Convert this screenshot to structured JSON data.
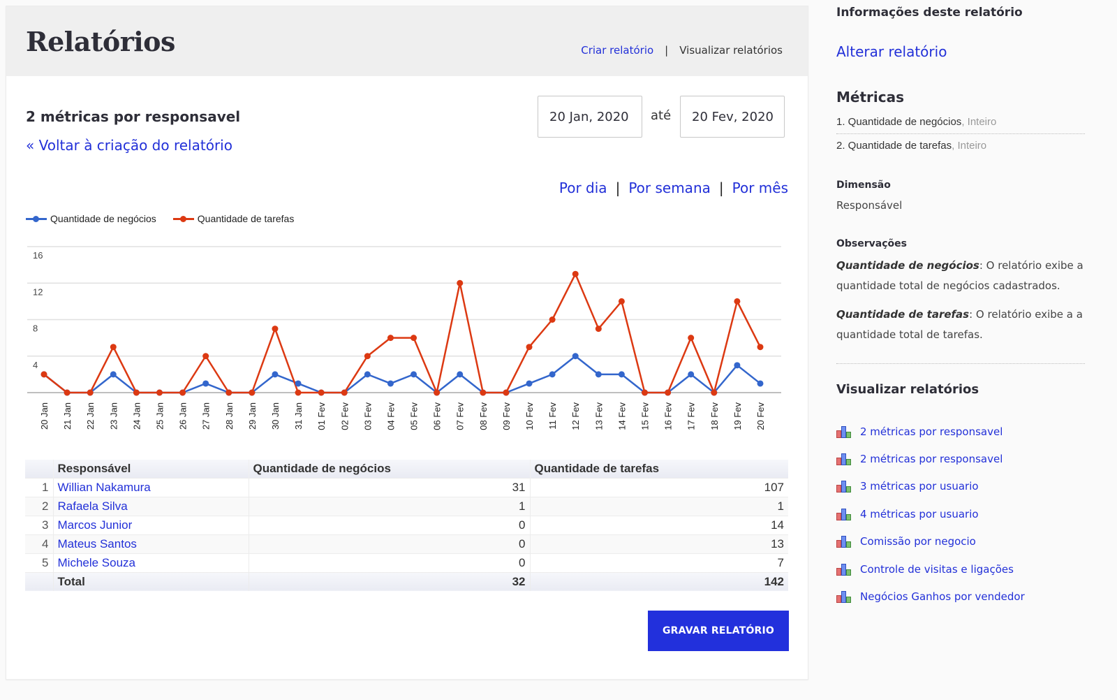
{
  "header": {
    "title": "Relatórios",
    "nav": {
      "create_label": "Criar relatório",
      "separator": "|",
      "view_label": "Visualizar relatórios"
    }
  },
  "report": {
    "name": "2 métricas por responsavel",
    "back_link": "« Voltar à criação do relatório",
    "date_from": "20 Jan, 2020",
    "date_separator": "até",
    "date_to": "20 Fev, 2020",
    "period": {
      "day": "Por dia",
      "week": "Por semana",
      "month": "Por mês",
      "separator": "|"
    }
  },
  "colors": {
    "negocios": "#3366cc",
    "tarefas": "#dc3912",
    "accent": "#2230dc",
    "link": "#2230d8"
  },
  "chart_data": {
    "type": "line",
    "title": "",
    "xlabel": "",
    "ylabel": "",
    "ylim": [
      0,
      16
    ],
    "yticks": [
      4,
      8,
      12,
      16
    ],
    "grid": true,
    "legend": "top-left",
    "x": [
      "20 Jan",
      "21 Jan",
      "22 Jan",
      "23 Jan",
      "24 Jan",
      "25 Jan",
      "26 Jan",
      "27 Jan",
      "28 Jan",
      "29 Jan",
      "30 Jan",
      "31 Jan",
      "01 Fev",
      "02 Fev",
      "03 Fev",
      "04 Fev",
      "05 Fev",
      "06 Fev",
      "07 Fev",
      "08 Fev",
      "09 Fev",
      "10 Fev",
      "11 Fev",
      "12 Fev",
      "13 Fev",
      "14 Fev",
      "15 Fev",
      "16 Fev",
      "17 Fev",
      "18 Fev",
      "19 Fev",
      "20 Fev"
    ],
    "series": [
      {
        "name": "Quantidade de negócios",
        "color": "#3366cc",
        "values": [
          2,
          0,
          0,
          2,
          0,
          0,
          0,
          1,
          0,
          0,
          2,
          1,
          0,
          0,
          2,
          1,
          2,
          0,
          2,
          0,
          0,
          1,
          2,
          4,
          2,
          2,
          0,
          0,
          2,
          0,
          3,
          1
        ]
      },
      {
        "name": "Quantidade de tarefas",
        "color": "#dc3912",
        "values": [
          2,
          0,
          0,
          5,
          0,
          0,
          0,
          4,
          0,
          0,
          7,
          0,
          0,
          0,
          4,
          6,
          6,
          0,
          12,
          0,
          0,
          5,
          8,
          13,
          7,
          10,
          0,
          0,
          6,
          0,
          10,
          5
        ]
      }
    ]
  },
  "table": {
    "headers": [
      "",
      "Responsável",
      "Quantidade de negócios",
      "Quantidade de tarefas"
    ],
    "rows": [
      {
        "index": "1",
        "name": "Willian Nakamura",
        "negocios": "31",
        "tarefas": "107"
      },
      {
        "index": "2",
        "name": "Rafaela Silva",
        "negocios": "1",
        "tarefas": "1"
      },
      {
        "index": "3",
        "name": "Marcos Junior",
        "negocios": "0",
        "tarefas": "14"
      },
      {
        "index": "4",
        "name": "Mateus Santos",
        "negocios": "0",
        "tarefas": "13"
      },
      {
        "index": "5",
        "name": "Michele Souza",
        "negocios": "0",
        "tarefas": "7"
      }
    ],
    "total": {
      "label": "Total",
      "negocios": "32",
      "tarefas": "142"
    }
  },
  "save_button": "GRAVAR RELATÓRIO",
  "sidebar": {
    "title": "Informações deste relatório",
    "edit_link": "Alterar relatório",
    "metrics_title": "Métricas",
    "metrics": [
      {
        "label": "1. Quantidade de negócios",
        "type": ", Inteiro"
      },
      {
        "label": "2. Quantidade de tarefas",
        "type": ", Inteiro"
      }
    ],
    "dimension_title": "Dimensão",
    "dimension_value": "Responsável",
    "observations_title": "Observações",
    "observations": [
      {
        "term": "Quantidade de negócios",
        "text": ": O relatório exibe a quantidade total de negócios cadastrados."
      },
      {
        "term": "Quantidade de tarefas",
        "text": ": O relatório exibe a a quantidade total de tarefas."
      }
    ],
    "reports_title": "Visualizar relatórios",
    "reports": [
      {
        "icon": "bar-chart-icon",
        "label": "2 métricas por responsavel"
      },
      {
        "icon": "bar-chart-icon",
        "label": "2 métricas por responsavel"
      },
      {
        "icon": "bar-chart-icon",
        "label": "3 métricas por usuario"
      },
      {
        "icon": "bar-chart-icon",
        "label": "4 métricas por usuario"
      },
      {
        "icon": "bar-chart-icon",
        "label": "Comissão por negocio"
      },
      {
        "icon": "bar-chart-icon",
        "label": "Controle de visitas e ligações"
      },
      {
        "icon": "bar-chart-icon",
        "label": "Negócios Ganhos por vendedor"
      }
    ]
  }
}
